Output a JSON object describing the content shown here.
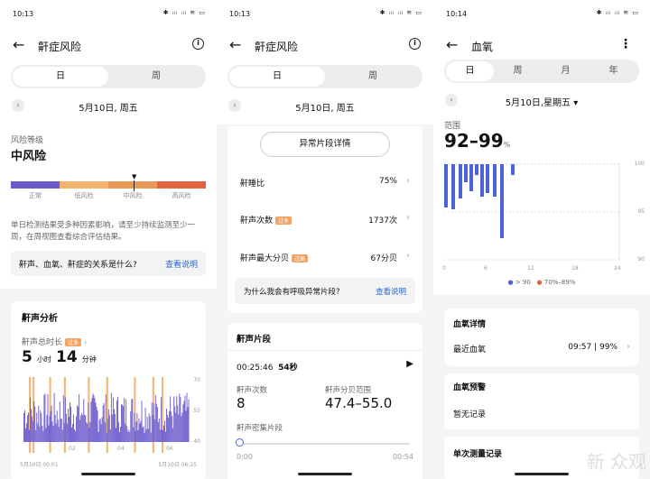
{
  "p1": {
    "time": "10:13",
    "status_icons": "✱ ᵢₗₗ ᵢₗₗ ≋ ▭",
    "title": "鼾症风险",
    "tab_day": "日",
    "tab_week": "周",
    "date": "5月10日, 周五",
    "risk_label": "风险等级",
    "risk_value": "中风险",
    "scale": [
      "正常",
      "低风险",
      "中风险",
      "高风险"
    ],
    "scale_colors": [
      "#6a5acd",
      "#f2b46e",
      "#ea9a57",
      "#e4633f"
    ],
    "desc": "单日检测结果受多种因素影响，请至少持续监测至少一周，在周视图查看综合评估结果。",
    "question": "鼾声、血氧、鼾症的关系是什么?",
    "question_link": "查看说明",
    "analysis_title": "鼾声分析",
    "total_label": "鼾声总时长",
    "total_tag": "过多",
    "hours": "5",
    "hours_unit": "小时",
    "minutes": "14",
    "minutes_unit": "分钟",
    "chart": {
      "y_ticks": [
        "70",
        "55",
        "40"
      ],
      "x_ticks": [
        "02",
        "04",
        "06"
      ],
      "start": "5月10日 00:01",
      "end": "5月10日 06:25"
    }
  },
  "p2": {
    "time": "10:13",
    "status_icons": "✱ ᵢₗₗ ᵢₗₗ ≋ ▭",
    "title": "鼾症风险",
    "tab_day": "日",
    "tab_week": "周",
    "date": "5月10日, 周五",
    "abn_button": "异常片段详情",
    "rows": [
      {
        "label": "鼾睡比",
        "tag": "",
        "value": "75%"
      },
      {
        "label": "鼾声次数",
        "tag": "过多",
        "value": "1737次"
      },
      {
        "label": "鼾声最大分贝",
        "tag": "过高",
        "value": "67分贝"
      }
    ],
    "question": "为什么我会有呼吸异常片段?",
    "question_link": "查看说明",
    "seg_title": "鼾声片段",
    "seg_time": "00:25:46",
    "seg_dur": "54秒",
    "count_label": "鼾声次数",
    "count_val": "8",
    "db_label": "鼾声分贝范围",
    "db_val": "47.4–55.0",
    "dense_label": "鼾声密集片段",
    "pos_start": "0:00",
    "pos_end": "00:54"
  },
  "p3": {
    "time": "10:14",
    "status_icons": "✱ ᵢₗₗ ᵢₗₗ ≋ ▭",
    "title": "血氧",
    "tabs": [
      "日",
      "周",
      "月",
      "年"
    ],
    "date": "5月10日,星期五 ▾",
    "range_label": "范围",
    "range_val": "92–99",
    "range_unit": "%",
    "chart": {
      "y_ticks": [
        "100",
        "95",
        "90"
      ],
      "x_ticks": [
        "0",
        "6",
        "12",
        "18",
        "24"
      ]
    },
    "legend": [
      {
        "label": "> 90",
        "color": "#4a63d8"
      },
      {
        "label": "70%–89%",
        "color": "#e4633f"
      }
    ],
    "detail_title": "血氧详情",
    "recent_label": "最近血氧",
    "recent_val": "09:57 | 99%",
    "warn_title": "血氧预警",
    "warn_val": "暂无记录",
    "single_title": "单次测量记录",
    "watermark": "新 众观"
  }
}
